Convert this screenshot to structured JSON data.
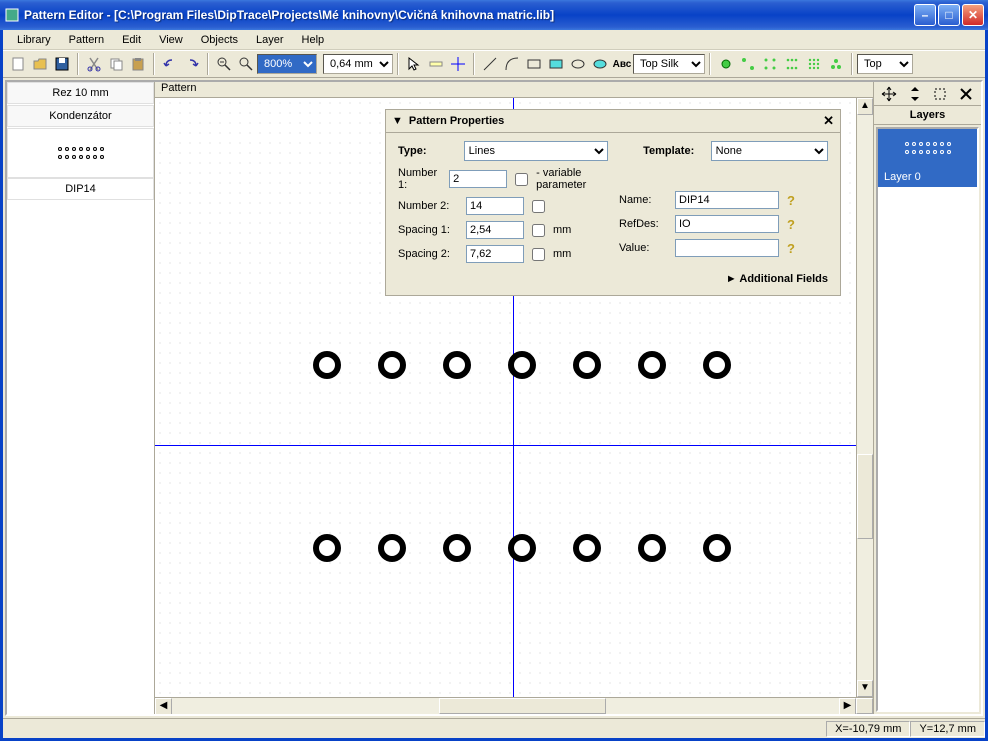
{
  "title": "Pattern Editor - [C:\\Program Files\\DipTrace\\Projects\\Mé knihovny\\Cvičná knihovna matric.lib]",
  "menu": [
    "Library",
    "Pattern",
    "Edit",
    "View",
    "Objects",
    "Layer",
    "Help"
  ],
  "toolbar": {
    "zoom": "800%",
    "grid": "0,64 mm",
    "layer_combo": "Top Silk",
    "side_combo": "Top"
  },
  "left_panel": {
    "item1": "Rez 10 mm",
    "item2": "Kondenzátor",
    "item3": "DIP14"
  },
  "canvas_label": "Pattern",
  "props": {
    "title": "Pattern Properties",
    "type_label": "Type:",
    "type_value": "Lines",
    "template_label": "Template:",
    "template_value": "None",
    "num1_label": "Number 1:",
    "num1_value": "2",
    "variable_param": "- variable parameter",
    "num2_label": "Number 2:",
    "num2_value": "14",
    "sp1_label": "Spacing 1:",
    "sp1_value": "2,54",
    "sp2_label": "Spacing 2:",
    "sp2_value": "7,62",
    "mm": "mm",
    "name_label": "Name:",
    "name_value": "DIP14",
    "refdes_label": "RefDes:",
    "refdes_value": "IO",
    "value_label": "Value:",
    "value_value": "",
    "additional": "Additional Fields"
  },
  "right_panel": {
    "layers_title": "Layers",
    "layer0": "Layer 0"
  },
  "status": {
    "x": "X=-10,79 mm",
    "y": "Y=12,7 mm"
  }
}
